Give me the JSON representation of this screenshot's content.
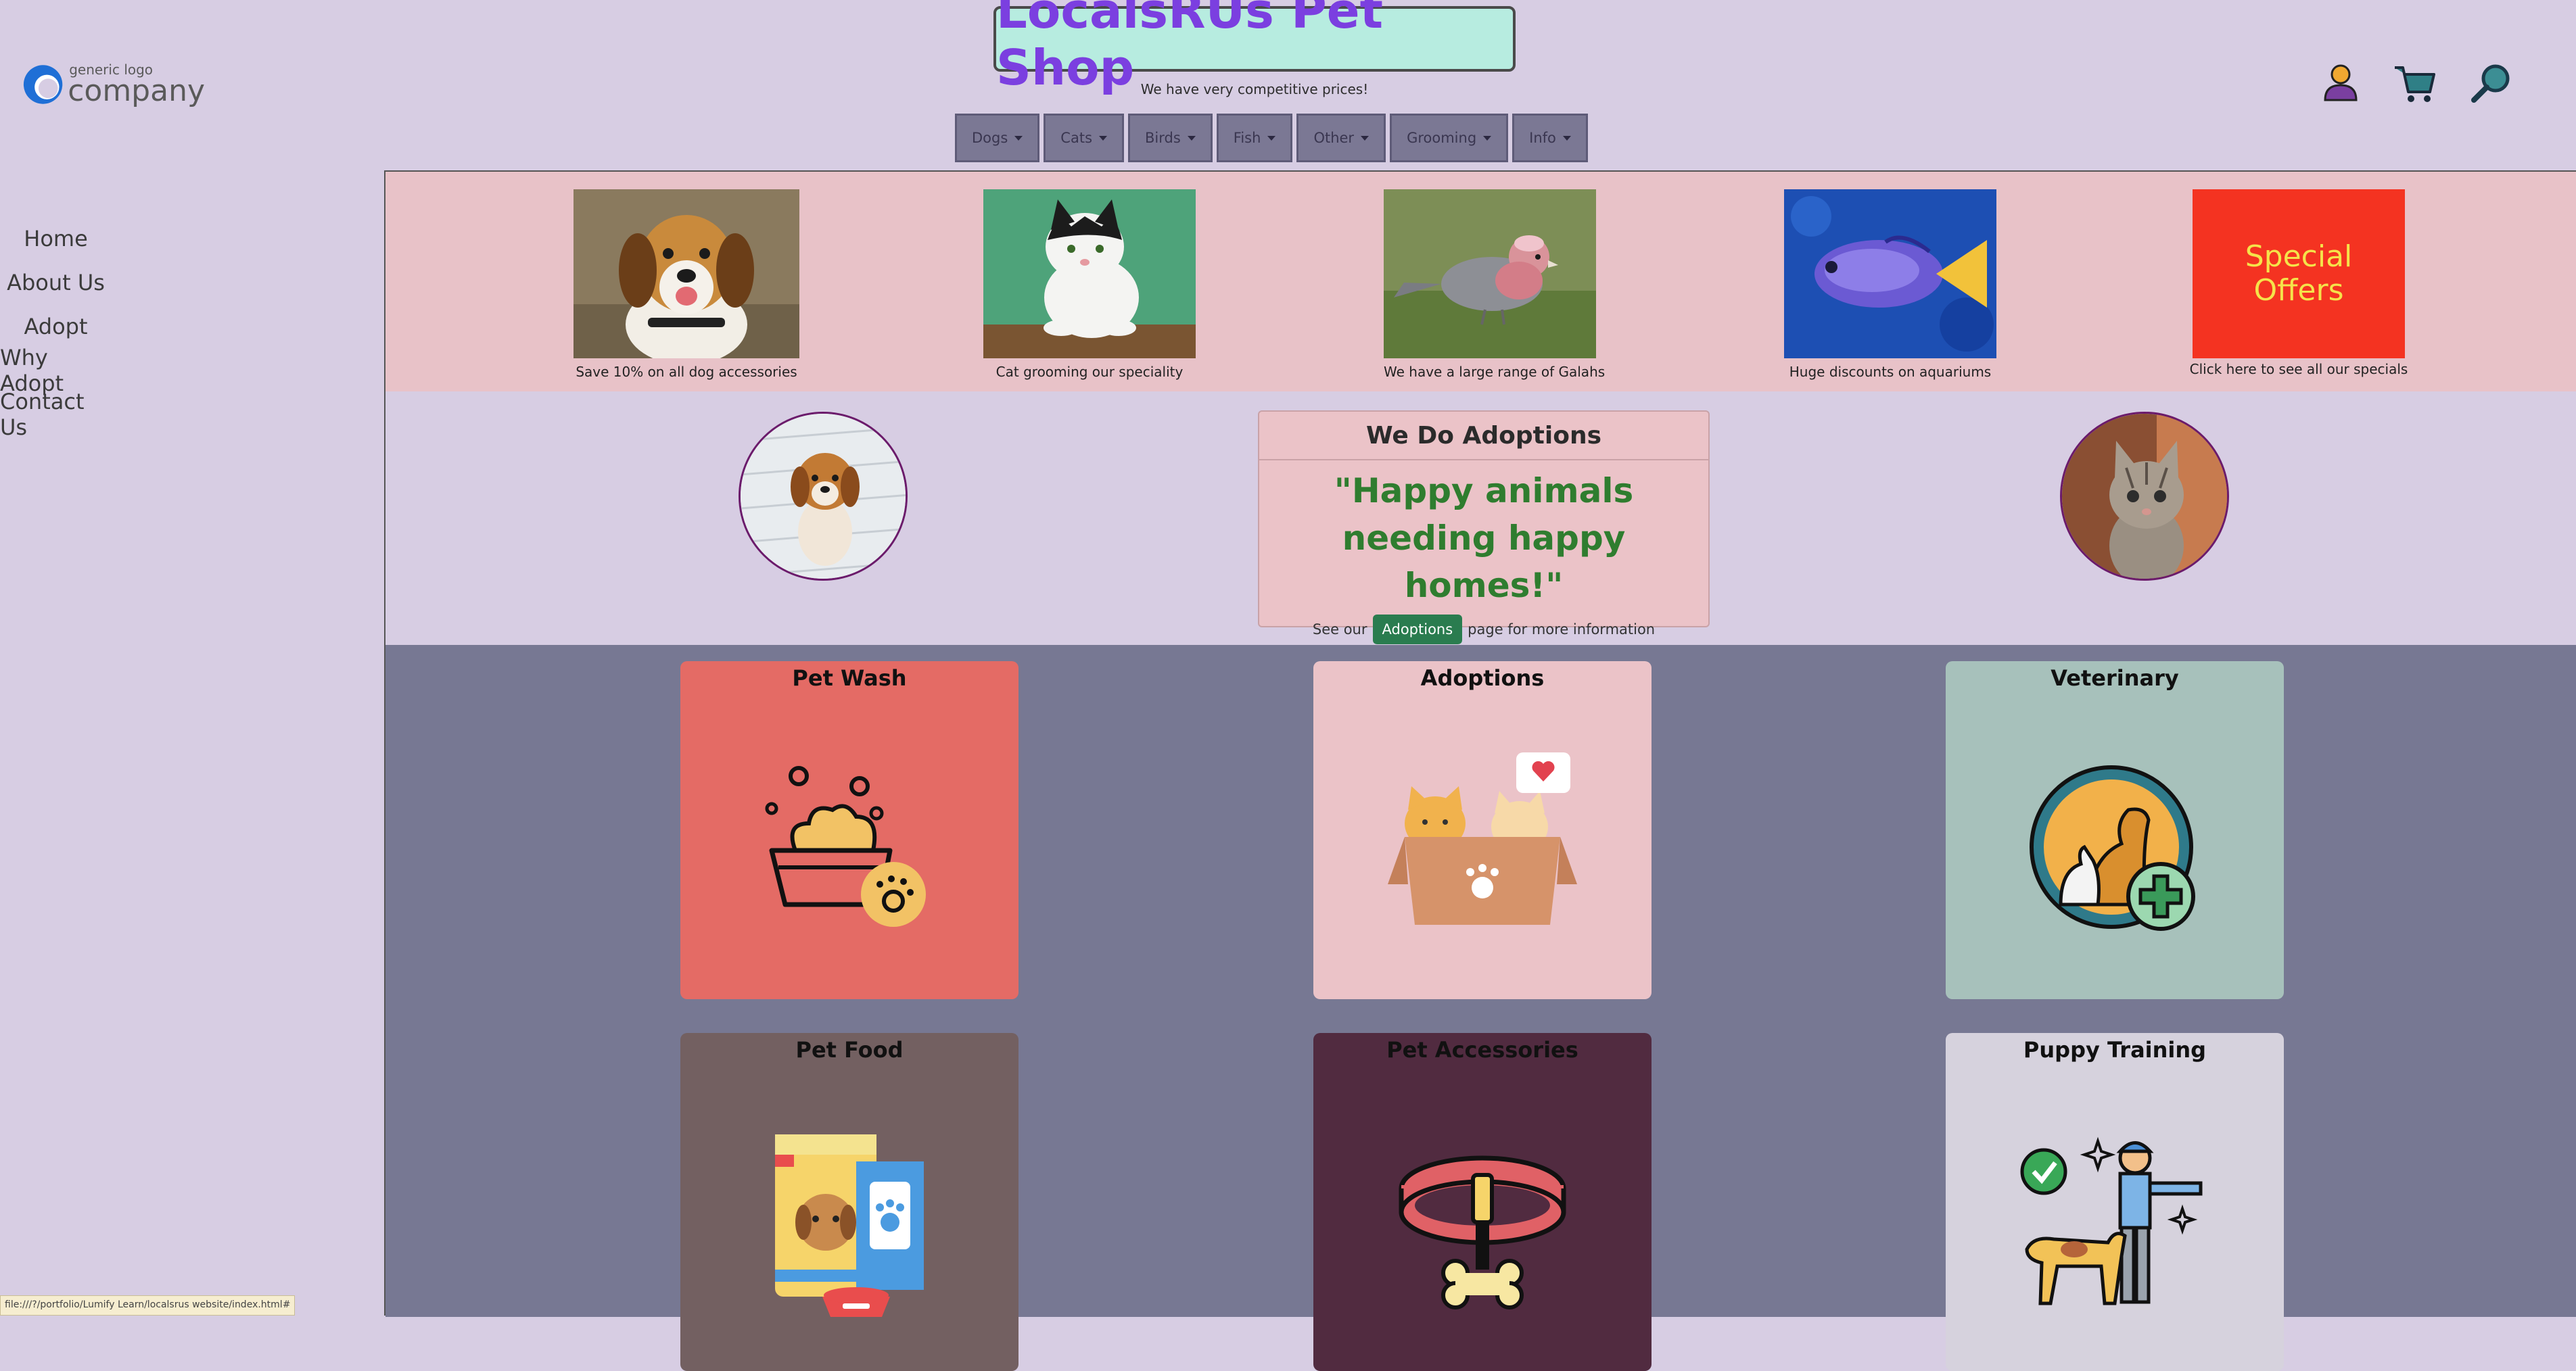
{
  "logo": {
    "small_text": "generic logo",
    "big_text": "company"
  },
  "header": {
    "title": "LocalsRUs Pet Shop",
    "tagline": "We have very competitive prices!",
    "menu": [
      "Dogs",
      "Cats",
      "Birds",
      "Fish",
      "Other",
      "Grooming",
      "Info"
    ],
    "icons": [
      "user-icon",
      "cart-icon",
      "search-icon"
    ]
  },
  "sidebar": {
    "items": [
      "Home",
      "About Us",
      "Adopt",
      "Why Adopt",
      "Contact Us"
    ]
  },
  "promos": [
    {
      "caption": "Save 10% on all dog accessories",
      "image": "beagle-photo"
    },
    {
      "caption": "Cat grooming our speciality",
      "image": "cat-photo"
    },
    {
      "caption": "We have a large range of Galahs",
      "image": "galah-photo"
    },
    {
      "caption": "Huge discounts on aquariums",
      "image": "fish-photo"
    },
    {
      "caption": "Click here to see all our specials",
      "image": "special-offers",
      "banner_text": "Special Offers"
    }
  ],
  "adoptions_card": {
    "heading": "We Do Adoptions",
    "quote": "\"Happy animals needing happy homes!\"",
    "pre_text": "See our",
    "button": "Adoptions",
    "post_text": "page for more information"
  },
  "services": [
    {
      "title": "Pet Wash",
      "icon": "pet-wash-icon",
      "color": "#e46b65"
    },
    {
      "title": "Adoptions",
      "icon": "adoption-box-icon",
      "color": "#ebc3c8"
    },
    {
      "title": "Veterinary",
      "icon": "veterinary-icon",
      "color": "#a7c1bb"
    },
    {
      "title": "Pet Food",
      "icon": "pet-food-icon",
      "color": "#736061"
    },
    {
      "title": "Pet Accessories",
      "icon": "collar-icon",
      "color": "#512b40"
    },
    {
      "title": "Puppy Training",
      "icon": "training-icon",
      "color": "#d6d2dd"
    }
  ],
  "status_bar": {
    "url": "file:///?/portfolio/Lumify Learn/localsrus website/index.html#"
  },
  "colors": {
    "background": "#d7cde3",
    "title_text": "#7b3fe0",
    "title_bg": "#b7ece0",
    "promo_band": "#e8c2c8",
    "services_band": "#777893",
    "adopt_button": "#2a7c4f",
    "quote": "#2f7d2f"
  }
}
